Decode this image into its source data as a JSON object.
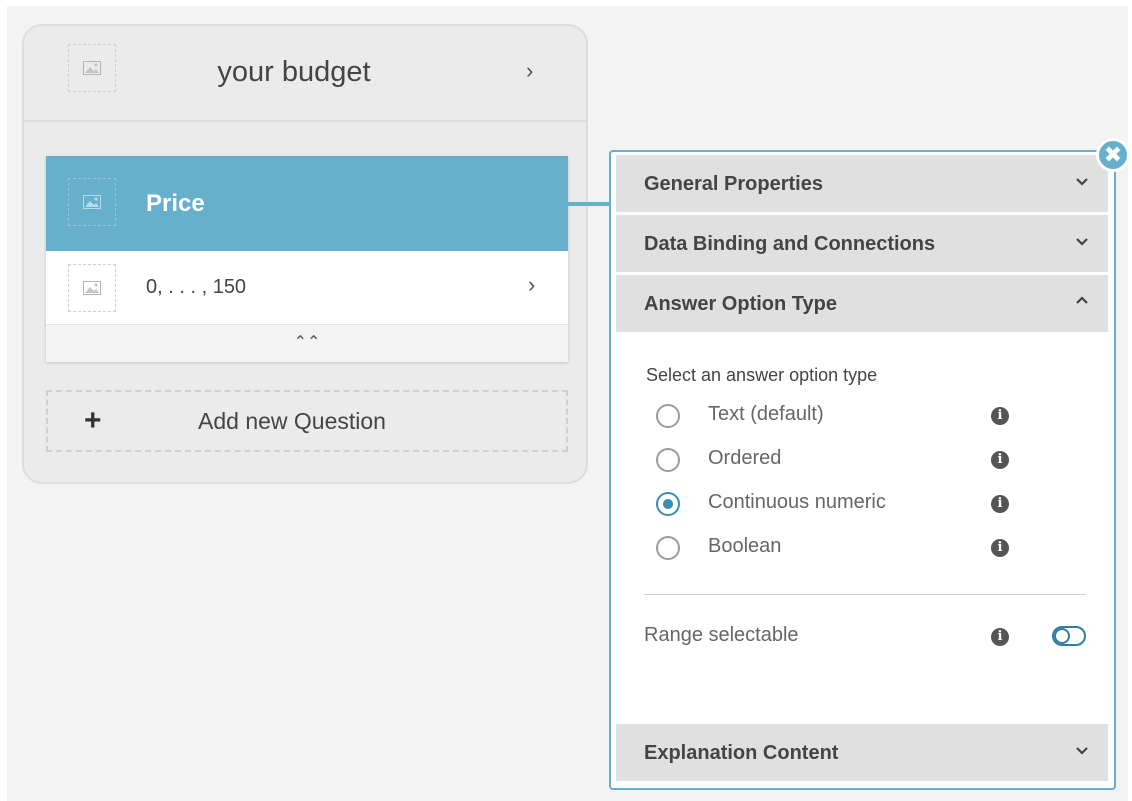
{
  "card": {
    "title": "your budget",
    "question": {
      "title": "Price",
      "answer": "0, . . . , 150"
    },
    "add_question_label": "Add new Question"
  },
  "panel": {
    "sections": {
      "general": "General Properties",
      "binding": "Data Binding and Connections",
      "answer_type": "Answer Option Type",
      "explanation": "Explanation Content"
    },
    "answer_type": {
      "prompt": "Select an answer option type",
      "options": [
        {
          "label": "Text (default)",
          "selected": false
        },
        {
          "label": "Ordered",
          "selected": false
        },
        {
          "label": "Continuous numeric",
          "selected": true
        },
        {
          "label": "Boolean",
          "selected": false
        }
      ],
      "range_label": "Range selectable",
      "range_enabled": false
    }
  },
  "icons": {
    "image_placeholder": "image-placeholder-icon",
    "chevron_right": "chevron-right-icon",
    "collapse": "double-chevron-up-icon",
    "plus": "plus-icon",
    "close": "close-icon",
    "info": "info-icon",
    "chevron_down": "chevron-down-icon",
    "chevron_up": "chevron-up-icon"
  },
  "colors": {
    "accent": "#66b0cc",
    "radio_selected": "#3a8fb0",
    "toggle": "#2e7fa6"
  }
}
